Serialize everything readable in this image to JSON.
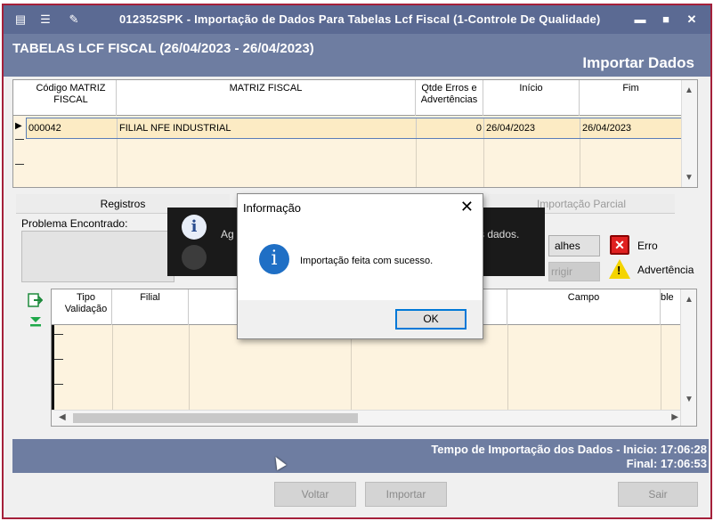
{
  "window": {
    "title": "012352SPK - Importação de Dados Para Tabelas Lcf Fiscal (1-Controle De Qualidade)",
    "app_icon": "app-menu-icon",
    "buttons": {
      "minimize": "▬",
      "maximize": "■",
      "close": "✕"
    }
  },
  "header": {
    "title": "TABELAS LCF FISCAL (26/04/2023 - 26/04/2023)",
    "action": "Importar Dados"
  },
  "grid_main": {
    "columns": [
      "Código MATRIZ FISCAL",
      "MATRIZ FISCAL",
      "Qtde Erros e Advertências",
      "Início",
      "Fim"
    ],
    "rows": [
      {
        "codigo": "000042",
        "matriz": "FILIAL NFE INDUSTRIAL",
        "qtde": "0",
        "inicio": "26/04/2023",
        "fim": "26/04/2023"
      }
    ]
  },
  "tabs": [
    "Registros",
    "Importação Parcial"
  ],
  "problem": {
    "label": "Problema Encontrado:"
  },
  "toast": {
    "left_text": "Ag",
    "right_text": "s dados."
  },
  "side_buttons": {
    "detalhes": "alhes",
    "corrigir": "rrigir"
  },
  "legend": {
    "erro": "Erro",
    "advertencia": "Advertência"
  },
  "grid_detail": {
    "columns": [
      "Tipo Validação",
      "Filial",
      "Campo",
      "ble"
    ]
  },
  "status": {
    "line1": "Tempo de Importação dos Dados - Inicio: 17:06:28",
    "line2": "Final: 17:06:53"
  },
  "footer_buttons": {
    "voltar": "Voltar",
    "importar": "Importar",
    "sair": "Sair"
  },
  "dialog": {
    "title": "Informação",
    "close": "✕",
    "message": "Importação feita com sucesso.",
    "ok": "OK"
  }
}
